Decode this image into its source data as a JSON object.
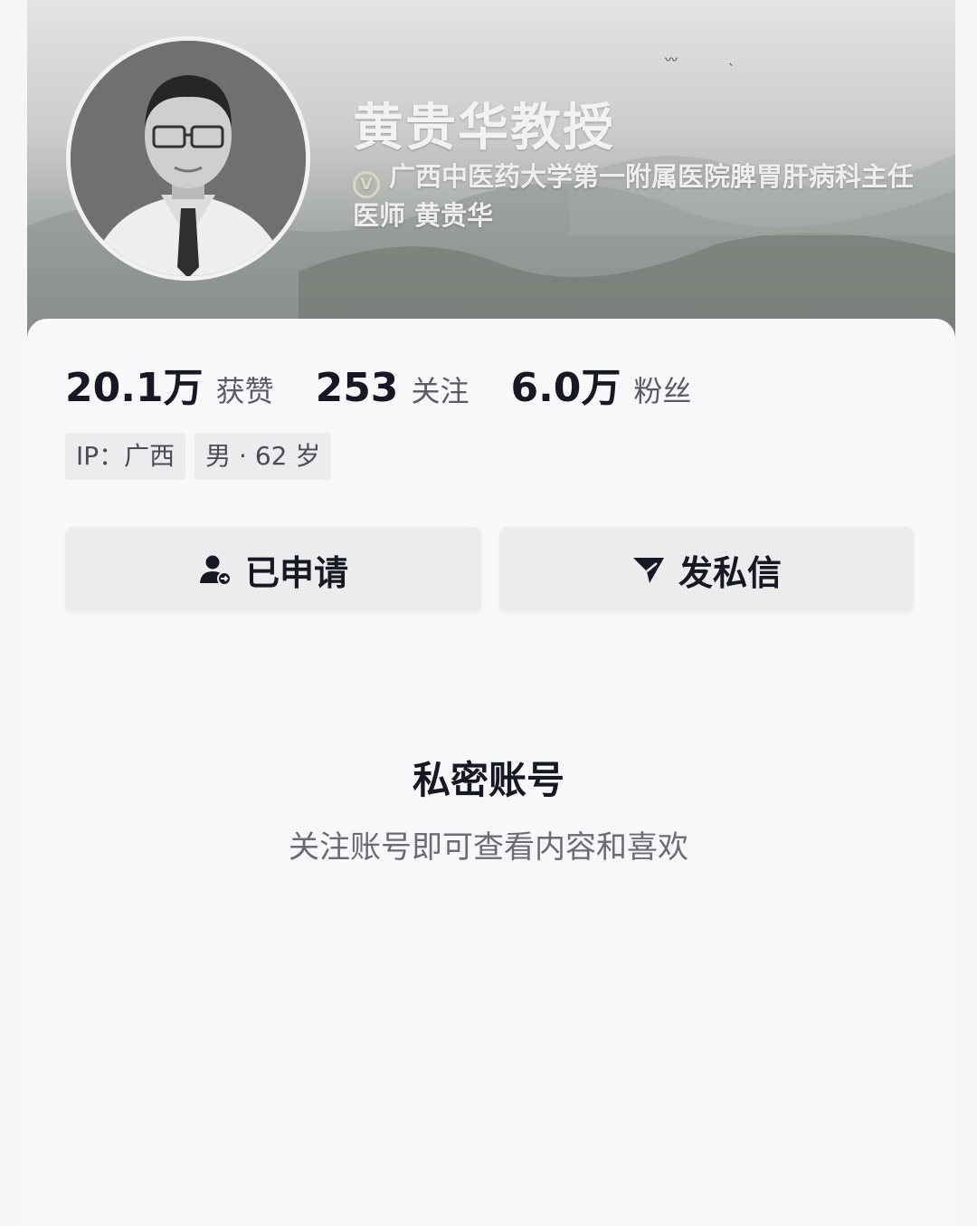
{
  "profile": {
    "name": "黄贵华教授",
    "verification": "广西中医药大学第一附属医院脾胃肝病科主任医师 黄贵华",
    "verify_badge": "V"
  },
  "stats": {
    "likes": {
      "value": "20.1万",
      "label": "获赞"
    },
    "following": {
      "value": "253",
      "label": "关注"
    },
    "followers": {
      "value": "6.0万",
      "label": "粉丝"
    }
  },
  "tags": {
    "ip": "IP：广西",
    "gender_age": "男 · 62 岁"
  },
  "actions": {
    "applied_label": "已申请",
    "message_label": "发私信"
  },
  "private": {
    "title": "私密账号",
    "description": "关注账号即可查看内容和喜欢"
  },
  "icons": {
    "verify": "verified-badge-icon",
    "applied": "user-pending-icon",
    "message": "send-message-icon"
  },
  "colors": {
    "text_primary": "#161823",
    "text_secondary": "#5a5b63",
    "button_bg": "#ececee",
    "card_bg": "#f8f8fa"
  }
}
